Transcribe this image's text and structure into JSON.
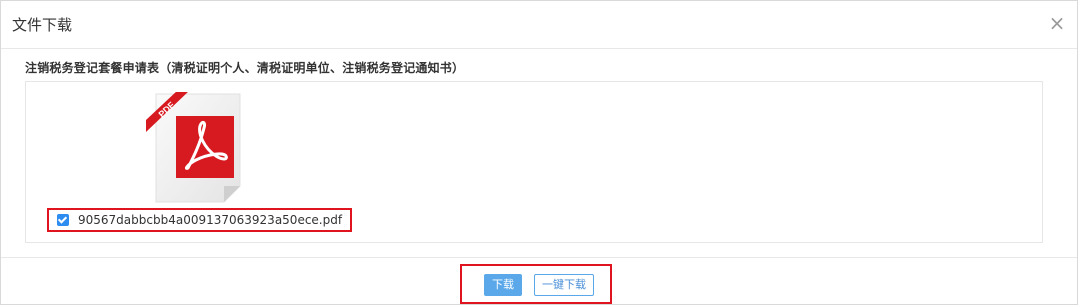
{
  "dialog": {
    "title": "文件下载",
    "close_symbol": "×"
  },
  "section": {
    "title": "注销税务登记套餐申请表（清税证明个人、清税证明单位、注销税务登记通知书）"
  },
  "files": [
    {
      "icon": "pdf-file-icon",
      "badge": "PDF",
      "name": "90567dabbcbb4a009137063923a50ece.pdf",
      "checked": true
    }
  ],
  "footer": {
    "download_label": "下载",
    "download_all_label": "一键下载"
  },
  "colors": {
    "accent_blue": "#5aa8ea",
    "checkbox_blue": "#2d8cf0",
    "highlight_red": "#e0141e",
    "pdf_red": "#d71920"
  }
}
